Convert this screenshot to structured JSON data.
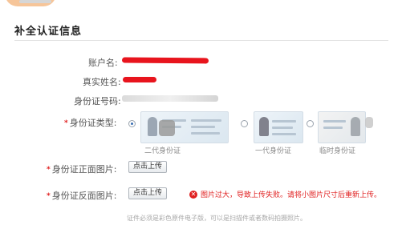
{
  "header": {
    "logo": "site-logo"
  },
  "page": {
    "title": "补全认证信息"
  },
  "form": {
    "account_label": "账户名:",
    "realname_label": "真实姓名:",
    "idnumber_label": "身份证号码:",
    "idtype_label": "身份证类型:",
    "idtype_options": [
      {
        "caption": "二代身份证",
        "selected": true
      },
      {
        "caption": "一代身份证",
        "selected": false
      },
      {
        "caption": "临时身份证",
        "selected": false
      }
    ],
    "front_label": "身份证正面图片:",
    "back_label": "身份证反面图片:",
    "upload_button": "点击上传",
    "error_text": "图片过大，导致上传失败。请将小图片尺寸后重新上传。",
    "note": "证件必须是彩色原件电子版，可以是扫描件或者数码拍摄照片。"
  },
  "colors": {
    "required": "#e02020",
    "redaction": "#e8141d",
    "accent": "#3b6fb2"
  }
}
